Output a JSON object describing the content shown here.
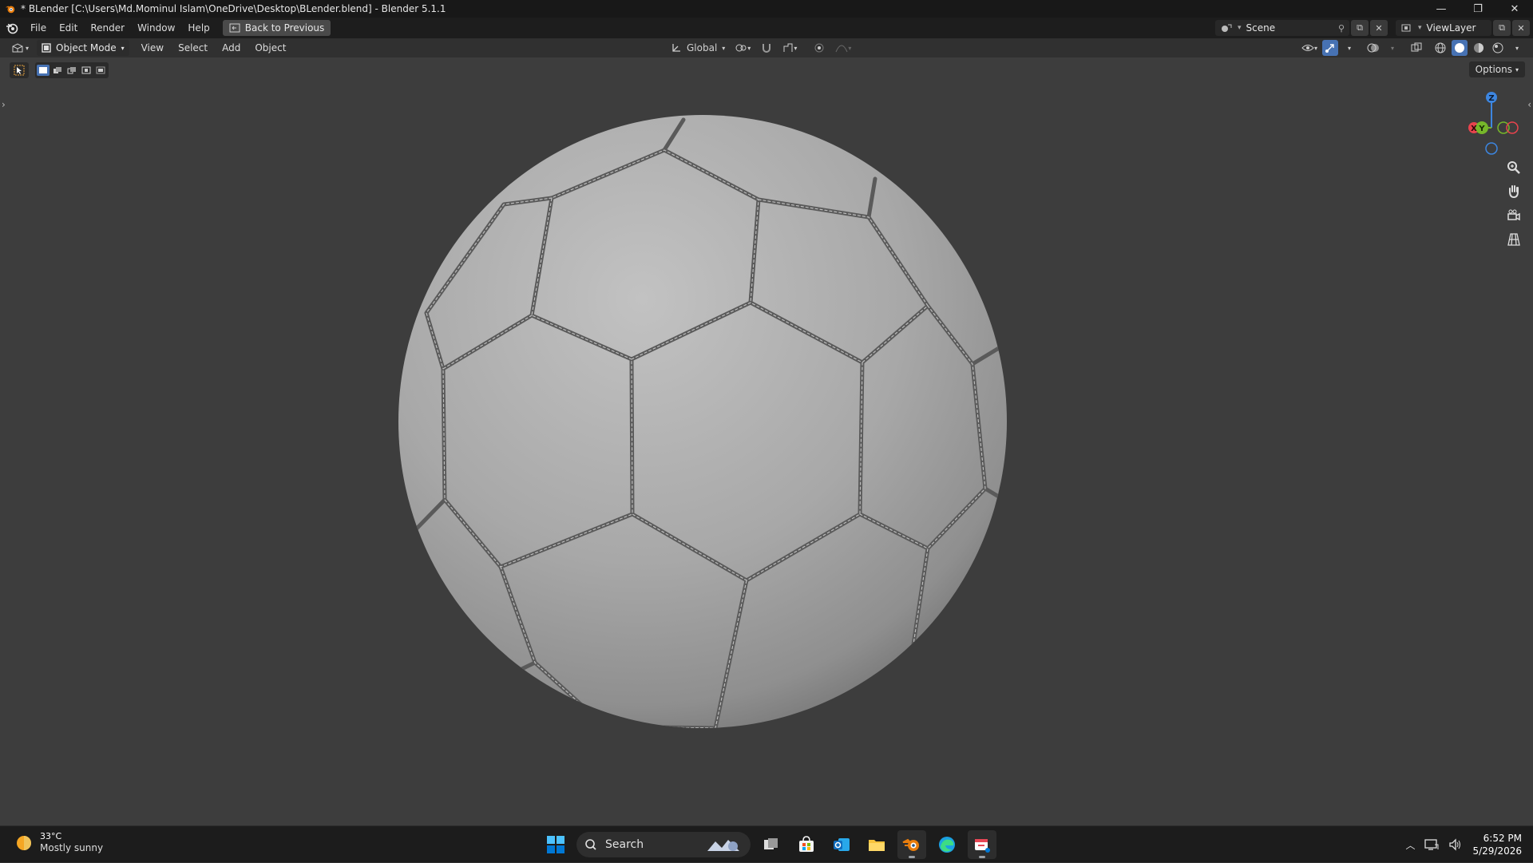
{
  "window": {
    "title": "* BLender [C:\\Users\\Md.Mominul Islam\\OneDrive\\Desktop\\BLender.blend] - Blender 5.1.1",
    "minimize_glyph": "—",
    "maximize_glyph": "❐",
    "close_glyph": "✕"
  },
  "topbar": {
    "menus": [
      "File",
      "Edit",
      "Render",
      "Window",
      "Help"
    ],
    "back_button": "Back to Previous",
    "scene_label": "Scene",
    "viewlayer_label": "ViewLayer"
  },
  "viewport_header": {
    "mode": "Object Mode",
    "menus": [
      "View",
      "Select",
      "Add",
      "Object"
    ],
    "orientation": "Global",
    "options_label": "Options"
  },
  "gizmo": {
    "x_label": "X",
    "y_label": "Y",
    "z_label": "Z",
    "x_color": "#e8434d",
    "y_color": "#76b72a",
    "z_color": "#3d86e0"
  },
  "accent_color": "#4772b3",
  "taskbar": {
    "weather_temp": "33°C",
    "weather_condition": "Mostly sunny",
    "search_label": "Search",
    "time": "6:52 PM",
    "date": "5/29/2026"
  },
  "icons": {
    "app": "blender-icon",
    "weather": "sun-icon",
    "start": "windows-start-icon",
    "search": "search-icon"
  }
}
